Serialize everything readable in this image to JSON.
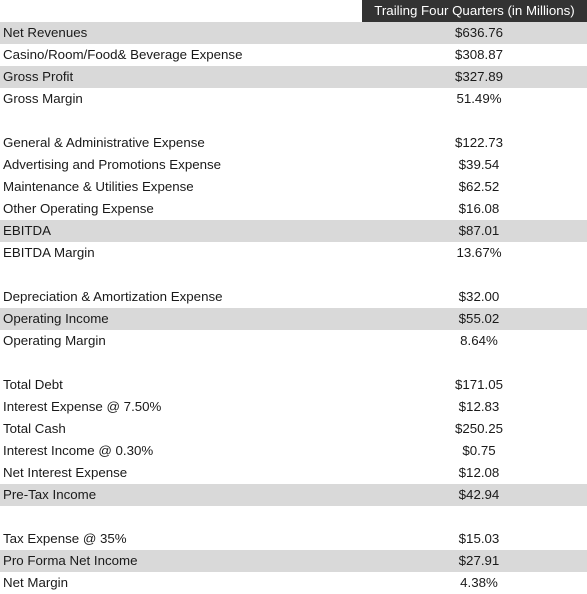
{
  "sheet": {
    "header": {
      "label_col_title": "",
      "value_col_title": "Trailing Four Quarters (in Millions)"
    },
    "colors": {
      "header_background": "#333333",
      "header_text": "#FFFFFF",
      "shaded_row": "#D9D9D9",
      "plain_row": "#FFFFFF",
      "body_text": "#1A1A1A"
    },
    "rows": [
      {
        "label": "Net Revenues",
        "value": "$636.76",
        "shaded": true
      },
      {
        "label": "Casino/Room/Food& Beverage Expense",
        "value": "$308.87",
        "shaded": false
      },
      {
        "label": "Gross Profit",
        "value": "$327.89",
        "shaded": true
      },
      {
        "label": "Gross Margin",
        "value": "51.49%",
        "shaded": false
      },
      {
        "label": "",
        "value": "",
        "shaded": false
      },
      {
        "label": "General & Administrative Expense",
        "value": "$122.73",
        "shaded": false
      },
      {
        "label": "Advertising and Promotions Expense",
        "value": "$39.54",
        "shaded": false
      },
      {
        "label": "Maintenance & Utilities Expense",
        "value": "$62.52",
        "shaded": false
      },
      {
        "label": "Other Operating Expense",
        "value": "$16.08",
        "shaded": false
      },
      {
        "label": "EBITDA",
        "value": "$87.01",
        "shaded": true
      },
      {
        "label": "EBITDA Margin",
        "value": "13.67%",
        "shaded": false
      },
      {
        "label": "",
        "value": "",
        "shaded": false
      },
      {
        "label": "Depreciation & Amortization Expense",
        "value": "$32.00",
        "shaded": false
      },
      {
        "label": "Operating Income",
        "value": "$55.02",
        "shaded": true
      },
      {
        "label": "Operating Margin",
        "value": "8.64%",
        "shaded": false
      },
      {
        "label": "",
        "value": "",
        "shaded": false
      },
      {
        "label": "Total Debt",
        "value": "$171.05",
        "shaded": false
      },
      {
        "label": "Interest Expense @ 7.50%",
        "value": "$12.83",
        "shaded": false
      },
      {
        "label": "Total Cash",
        "value": "$250.25",
        "shaded": false
      },
      {
        "label": "Interest Income @ 0.30%",
        "value": "$0.75",
        "shaded": false
      },
      {
        "label": "Net Interest Expense",
        "value": "$12.08",
        "shaded": false
      },
      {
        "label": "Pre-Tax Income",
        "value": "$42.94",
        "shaded": true
      },
      {
        "label": "",
        "value": "",
        "shaded": false
      },
      {
        "label": "Tax Expense @ 35%",
        "value": "$15.03",
        "shaded": false
      },
      {
        "label": "Pro Forma Net Income",
        "value": "$27.91",
        "shaded": true
      },
      {
        "label": "Net Margin",
        "value": "4.38%",
        "shaded": false
      }
    ]
  }
}
